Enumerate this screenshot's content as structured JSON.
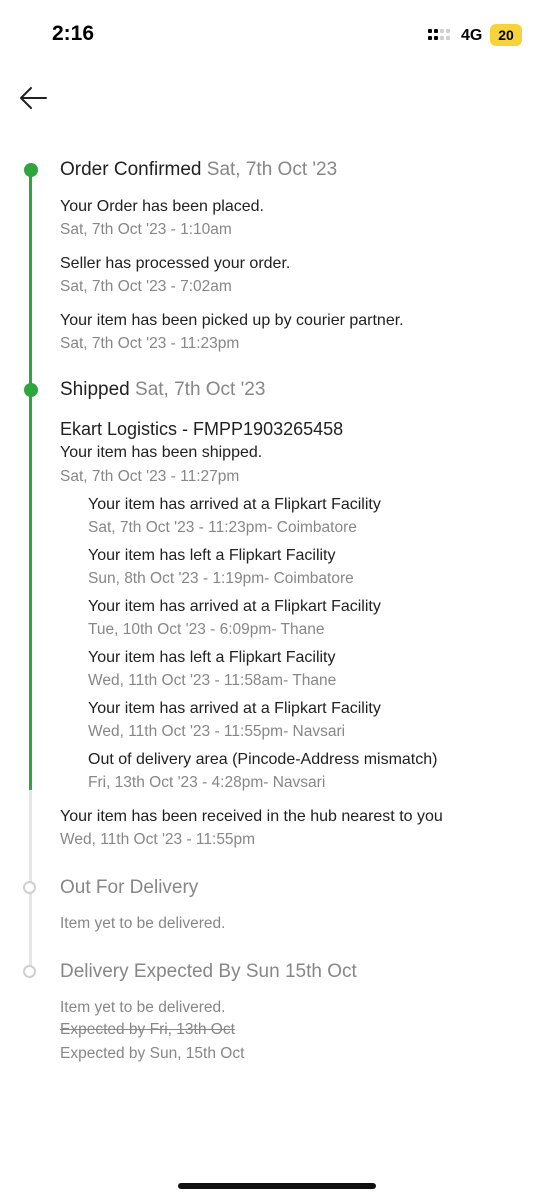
{
  "status_bar": {
    "time": "2:16",
    "network": "4G",
    "battery": "20"
  },
  "timeline": {
    "order_confirmed": {
      "title": "Order Confirmed",
      "date": "Sat, 7th Oct '23",
      "events": [
        {
          "text": "Your Order has been placed.",
          "time": "Sat, 7th Oct '23 - 1:10am"
        },
        {
          "text": "Seller has processed your order.",
          "time": "Sat, 7th Oct '23 - 7:02am"
        },
        {
          "text": "Your item has been picked up by courier partner.",
          "time": "Sat, 7th Oct '23 - 11:23pm"
        }
      ]
    },
    "shipped": {
      "title": "Shipped",
      "date": "Sat, 7th Oct '23",
      "courier": "Ekart Logistics - FMPP1903265458",
      "shipped_text": "Your item has been shipped.",
      "shipped_time": "Sat, 7th Oct '23 - 11:27pm",
      "sub_events": [
        {
          "text": "Your item has arrived at a Flipkart Facility",
          "time": "Sat, 7th Oct '23 - 11:23pm- Coimbatore"
        },
        {
          "text": "Your item has left a Flipkart Facility",
          "time": "Sun, 8th Oct '23 - 1:19pm- Coimbatore"
        },
        {
          "text": "Your item has arrived at a Flipkart Facility",
          "time": "Tue, 10th Oct '23 - 6:09pm- Thane"
        },
        {
          "text": "Your item has left a Flipkart Facility",
          "time": "Wed, 11th Oct '23 - 11:58am- Thane"
        },
        {
          "text": "Your item has arrived at a Flipkart Facility",
          "time": "Wed, 11th Oct '23 - 11:55pm- Navsari"
        },
        {
          "text": "Out of delivery area (Pincode-Address mismatch)",
          "time": "Fri, 13th Oct '23 - 4:28pm- Navsari"
        }
      ],
      "hub_text": "Your item has been received in the hub nearest to you",
      "hub_time": "Wed, 11th Oct '23 - 11:55pm"
    },
    "out_for_delivery": {
      "title": "Out For Delivery",
      "note": "Item yet to be delivered."
    },
    "delivery_expected": {
      "title": "Delivery Expected By Sun 15th Oct",
      "note": "Item yet to be delivered.",
      "old_expected": "Expected by Fri, 13th Oct",
      "new_expected": "Expected by Sun, 15th Oct"
    }
  },
  "colors": {
    "accent_green": "#2fa53e",
    "pending_grey": "#cfcfcf",
    "muted_text": "#878787"
  }
}
